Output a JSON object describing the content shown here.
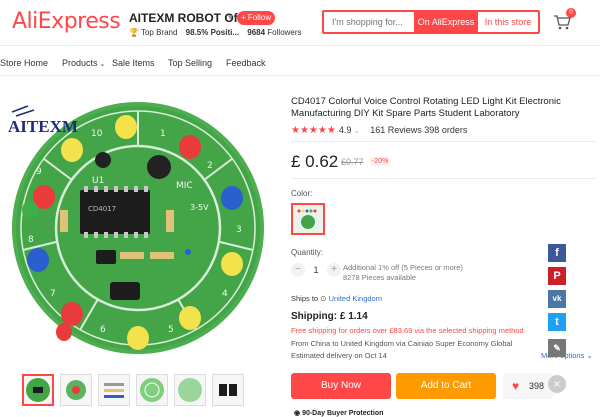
{
  "header": {
    "logo": "AliExpress",
    "store_name": "AITEXM ROBOT Offic...",
    "follow_label": "+ Follow",
    "top_brand": "Top Brand",
    "positive": "98.5% Positi...",
    "followers_count": "9684",
    "followers_label": "Followers",
    "search_placeholder": "I'm shopping for...",
    "search_aliexpress": "On AliExpress",
    "search_store": "In this store",
    "cart_count": "0"
  },
  "nav": {
    "items": [
      "Store Home",
      "Products",
      "Sale Items",
      "Top Selling",
      "Feedback"
    ]
  },
  "product": {
    "brand_watermark": "AITEXM",
    "title": "CD4017 Colorful Voice Control Rotating LED Light Kit Electronic Manufacturing DIY Kit Spare Parts Student Laboratory",
    "rating": "4.9",
    "reviews": "161 Reviews",
    "orders": "398 orders",
    "price": "£ 0.62",
    "old_price": "£0.77",
    "discount": "-20%",
    "color_label": "Color:",
    "quantity_label": "Quantity:",
    "quantity_value": "1",
    "quantity_note_1": "Additional 1% off (5 Pieces or more)",
    "quantity_note_2": "8278 Pieces available",
    "ships_to_label": "Ships to",
    "ships_to_value": "United Kingdom",
    "shipping_label": "Shipping: £ 1.14",
    "free_shipping": "Free shipping for orders over £83.69 via the selected shipping method",
    "from_line": "From China to United Kingdom via Cainiao Super Economy Global",
    "delivery": "Estimated delivery on Oct 14",
    "more_options": "More options ⌄",
    "buy_now": "Buy Now",
    "add_to_cart": "Add to Cart",
    "wishlist_count": "398",
    "protection": "90-Day Buyer Protection"
  },
  "board_labels": {
    "chip": "CD4017",
    "u1": "U1",
    "mic": "MIC",
    "voltage": "3-5V",
    "numbers": [
      "1",
      "2",
      "3",
      "4",
      "5",
      "6",
      "7",
      "8",
      "9",
      "10"
    ]
  },
  "colors": {
    "accent": "#ff4747",
    "orange": "#ff9a00",
    "link": "#2e6fd8",
    "board_green": "#3fa34a"
  }
}
